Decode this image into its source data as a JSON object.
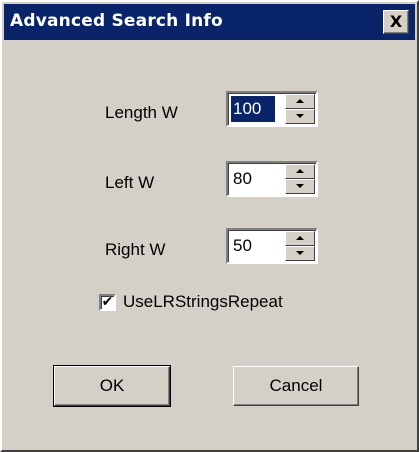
{
  "window": {
    "title": "Advanced Search Info",
    "close_symbol": "X"
  },
  "fields": [
    {
      "label": "Length W",
      "value": "100",
      "selected": true
    },
    {
      "label": "Left W",
      "value": "80",
      "selected": false
    },
    {
      "label": "Right W",
      "value": "50",
      "selected": false
    }
  ],
  "checkbox": {
    "label": "UseLRStringsRepeat",
    "checked": true,
    "mark": "✔"
  },
  "buttons": {
    "ok_label": "OK",
    "cancel_label": "Cancel"
  },
  "icons": {
    "close": "close-icon",
    "spin_up": "arrow-up-icon",
    "spin_down": "arrow-down-icon",
    "check": "checkmark-icon"
  },
  "colors": {
    "titlebar": "#0a246a",
    "face": "#d4d0c8",
    "selection": "#0a246a"
  }
}
